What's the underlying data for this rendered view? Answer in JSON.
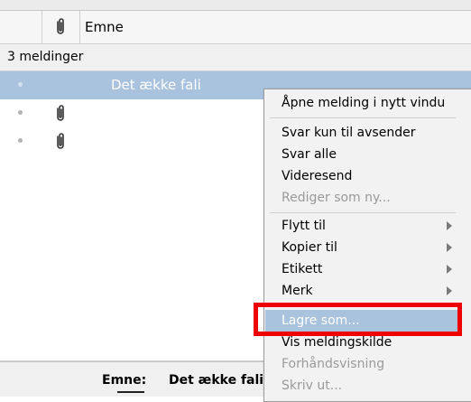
{
  "header": {
    "attachment_icon": "paperclip-icon",
    "subject_label": "Emne"
  },
  "thread": {
    "count_label": "3 meldinger",
    "messages": [
      {
        "subject": "Det ække fali",
        "attachment": false,
        "selected": true
      },
      {
        "subject": "",
        "attachment": true,
        "selected": false
      },
      {
        "subject": "",
        "attachment": true,
        "selected": false
      }
    ]
  },
  "preview": {
    "subject_label": "Emne:",
    "subject_value": "Det ække fali"
  },
  "context_menu": {
    "items": [
      {
        "label": "Åpne melding i nytt vindu"
      },
      {
        "label": "Svar kun til avsender"
      },
      {
        "label": "Svar alle"
      },
      {
        "label": "Videresend"
      },
      {
        "label": "Rediger som ny...",
        "disabled": true
      },
      {
        "label": "Flytt til",
        "submenu": true
      },
      {
        "label": "Kopier til",
        "submenu": true
      },
      {
        "label": "Etikett",
        "submenu": true
      },
      {
        "label": "Merk",
        "submenu": true
      },
      {
        "label": "Lagre som...",
        "highlighted": true
      },
      {
        "label": "Vis meldingskilde"
      },
      {
        "label": "Forhåndsvisning",
        "disabled": true
      },
      {
        "label": "Skriv ut...",
        "disabled": true
      }
    ]
  },
  "colors": {
    "selection": "#a9c3de",
    "annotation_box": "#ee0000"
  }
}
